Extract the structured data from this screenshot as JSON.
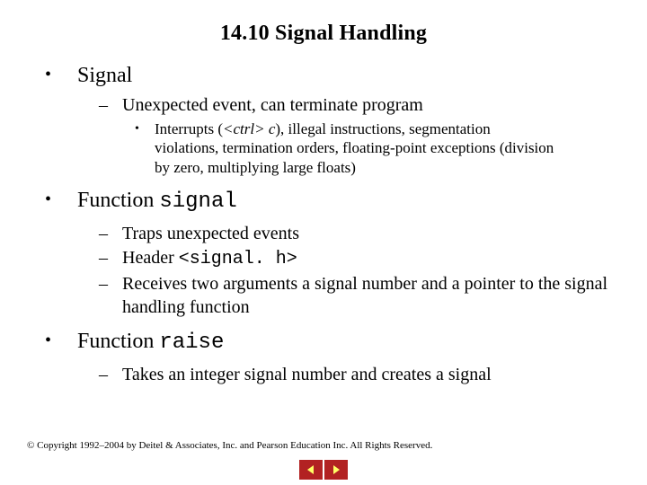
{
  "title": "14.10  Signal Handling",
  "bullets": {
    "signal_label": "Signal",
    "signal_sub1": "Unexpected event, can terminate program",
    "signal_sub1a_pre": "Interrupts (",
    "signal_sub1a_ctrl": "<ctrl>",
    "signal_sub1a_c": " c",
    "signal_sub1a_post": "), illegal instructions, segmentation violations, termination orders, floating-point exceptions (division by zero, multiplying large floats)",
    "func_signal_pre": "Function ",
    "func_signal_code": "signal",
    "func_signal_sub1": "Traps unexpected events",
    "func_signal_sub2_pre": "Header ",
    "func_signal_sub2_code": "<signal. h>",
    "func_signal_sub3": "Receives two arguments a signal number and a pointer to the signal handling function",
    "func_raise_pre": "Function ",
    "func_raise_code": "raise",
    "func_raise_sub1": "Takes an integer signal number and creates a signal"
  },
  "copyright": "© Copyright 1992–2004 by Deitel & Associates, Inc. and Pearson Education Inc. All Rights Reserved.",
  "nav": {
    "prev": "previous",
    "next": "next"
  }
}
